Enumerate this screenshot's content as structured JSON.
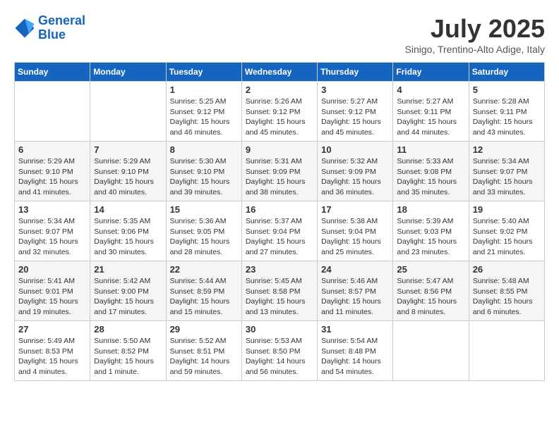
{
  "logo": {
    "line1": "General",
    "line2": "Blue"
  },
  "title": "July 2025",
  "subtitle": "Sinigo, Trentino-Alto Adige, Italy",
  "days_header": [
    "Sunday",
    "Monday",
    "Tuesday",
    "Wednesday",
    "Thursday",
    "Friday",
    "Saturday"
  ],
  "weeks": [
    [
      {
        "day": "",
        "info": ""
      },
      {
        "day": "",
        "info": ""
      },
      {
        "day": "1",
        "info": "Sunrise: 5:25 AM\nSunset: 9:12 PM\nDaylight: 15 hours\nand 46 minutes."
      },
      {
        "day": "2",
        "info": "Sunrise: 5:26 AM\nSunset: 9:12 PM\nDaylight: 15 hours\nand 45 minutes."
      },
      {
        "day": "3",
        "info": "Sunrise: 5:27 AM\nSunset: 9:12 PM\nDaylight: 15 hours\nand 45 minutes."
      },
      {
        "day": "4",
        "info": "Sunrise: 5:27 AM\nSunset: 9:11 PM\nDaylight: 15 hours\nand 44 minutes."
      },
      {
        "day": "5",
        "info": "Sunrise: 5:28 AM\nSunset: 9:11 PM\nDaylight: 15 hours\nand 43 minutes."
      }
    ],
    [
      {
        "day": "6",
        "info": "Sunrise: 5:29 AM\nSunset: 9:10 PM\nDaylight: 15 hours\nand 41 minutes."
      },
      {
        "day": "7",
        "info": "Sunrise: 5:29 AM\nSunset: 9:10 PM\nDaylight: 15 hours\nand 40 minutes."
      },
      {
        "day": "8",
        "info": "Sunrise: 5:30 AM\nSunset: 9:10 PM\nDaylight: 15 hours\nand 39 minutes."
      },
      {
        "day": "9",
        "info": "Sunrise: 5:31 AM\nSunset: 9:09 PM\nDaylight: 15 hours\nand 38 minutes."
      },
      {
        "day": "10",
        "info": "Sunrise: 5:32 AM\nSunset: 9:09 PM\nDaylight: 15 hours\nand 36 minutes."
      },
      {
        "day": "11",
        "info": "Sunrise: 5:33 AM\nSunset: 9:08 PM\nDaylight: 15 hours\nand 35 minutes."
      },
      {
        "day": "12",
        "info": "Sunrise: 5:34 AM\nSunset: 9:07 PM\nDaylight: 15 hours\nand 33 minutes."
      }
    ],
    [
      {
        "day": "13",
        "info": "Sunrise: 5:34 AM\nSunset: 9:07 PM\nDaylight: 15 hours\nand 32 minutes."
      },
      {
        "day": "14",
        "info": "Sunrise: 5:35 AM\nSunset: 9:06 PM\nDaylight: 15 hours\nand 30 minutes."
      },
      {
        "day": "15",
        "info": "Sunrise: 5:36 AM\nSunset: 9:05 PM\nDaylight: 15 hours\nand 28 minutes."
      },
      {
        "day": "16",
        "info": "Sunrise: 5:37 AM\nSunset: 9:04 PM\nDaylight: 15 hours\nand 27 minutes."
      },
      {
        "day": "17",
        "info": "Sunrise: 5:38 AM\nSunset: 9:04 PM\nDaylight: 15 hours\nand 25 minutes."
      },
      {
        "day": "18",
        "info": "Sunrise: 5:39 AM\nSunset: 9:03 PM\nDaylight: 15 hours\nand 23 minutes."
      },
      {
        "day": "19",
        "info": "Sunrise: 5:40 AM\nSunset: 9:02 PM\nDaylight: 15 hours\nand 21 minutes."
      }
    ],
    [
      {
        "day": "20",
        "info": "Sunrise: 5:41 AM\nSunset: 9:01 PM\nDaylight: 15 hours\nand 19 minutes."
      },
      {
        "day": "21",
        "info": "Sunrise: 5:42 AM\nSunset: 9:00 PM\nDaylight: 15 hours\nand 17 minutes."
      },
      {
        "day": "22",
        "info": "Sunrise: 5:44 AM\nSunset: 8:59 PM\nDaylight: 15 hours\nand 15 minutes."
      },
      {
        "day": "23",
        "info": "Sunrise: 5:45 AM\nSunset: 8:58 PM\nDaylight: 15 hours\nand 13 minutes."
      },
      {
        "day": "24",
        "info": "Sunrise: 5:46 AM\nSunset: 8:57 PM\nDaylight: 15 hours\nand 11 minutes."
      },
      {
        "day": "25",
        "info": "Sunrise: 5:47 AM\nSunset: 8:56 PM\nDaylight: 15 hours\nand 8 minutes."
      },
      {
        "day": "26",
        "info": "Sunrise: 5:48 AM\nSunset: 8:55 PM\nDaylight: 15 hours\nand 6 minutes."
      }
    ],
    [
      {
        "day": "27",
        "info": "Sunrise: 5:49 AM\nSunset: 8:53 PM\nDaylight: 15 hours\nand 4 minutes."
      },
      {
        "day": "28",
        "info": "Sunrise: 5:50 AM\nSunset: 8:52 PM\nDaylight: 15 hours\nand 1 minute."
      },
      {
        "day": "29",
        "info": "Sunrise: 5:52 AM\nSunset: 8:51 PM\nDaylight: 14 hours\nand 59 minutes."
      },
      {
        "day": "30",
        "info": "Sunrise: 5:53 AM\nSunset: 8:50 PM\nDaylight: 14 hours\nand 56 minutes."
      },
      {
        "day": "31",
        "info": "Sunrise: 5:54 AM\nSunset: 8:48 PM\nDaylight: 14 hours\nand 54 minutes."
      },
      {
        "day": "",
        "info": ""
      },
      {
        "day": "",
        "info": ""
      }
    ]
  ]
}
